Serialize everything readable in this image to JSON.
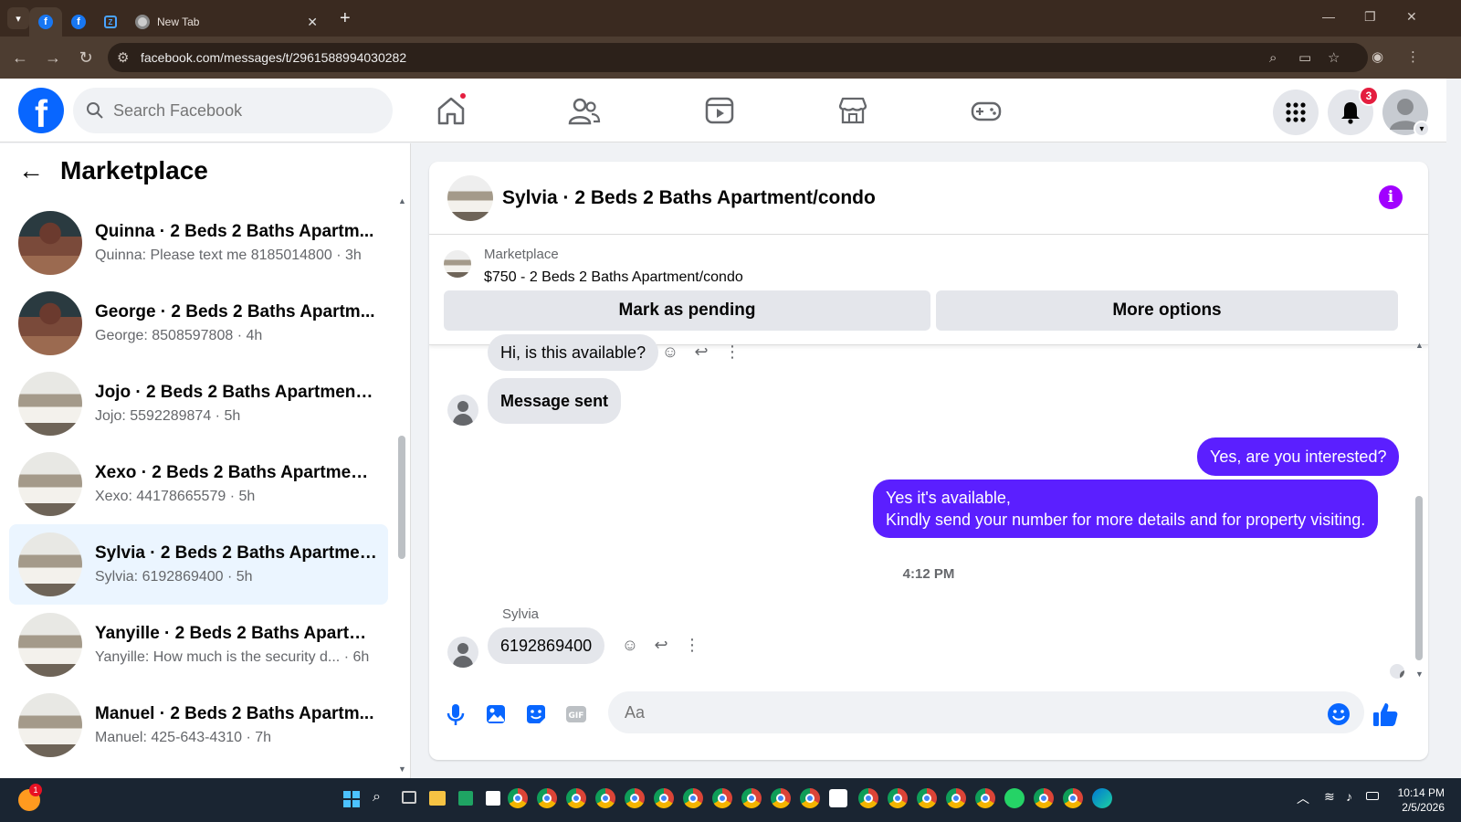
{
  "browser": {
    "tabs": [
      {
        "label": "",
        "icon": "facebook-icon",
        "active": true
      },
      {
        "label": "",
        "icon": "facebook-icon",
        "active": false
      },
      {
        "label": "",
        "icon": "zillow-icon",
        "active": false
      },
      {
        "label": "New Tab",
        "icon": "chrome-icon",
        "active": false
      }
    ],
    "url": "facebook.com/messages/t/2961588994030282"
  },
  "header": {
    "search_placeholder": "Search Facebook",
    "notifications_count": "3"
  },
  "sidebar": {
    "title": "Marketplace",
    "conversations": [
      {
        "name": "Quinna · 2 Beds 2 Baths Apartm...",
        "preview": "Quinna: Please text me 8185014800 · 3h",
        "thumb": "dark",
        "selected": false
      },
      {
        "name": "George · 2 Beds 2 Baths Apartm...",
        "preview": "George: 8508597808 · 4h",
        "thumb": "dark",
        "selected": false
      },
      {
        "name": "Jojo · 2 Beds 2 Baths Apartment/...",
        "preview": "Jojo: 5592289874 · 5h",
        "thumb": "light",
        "selected": false
      },
      {
        "name": "Xexo · 2 Beds 2 Baths Apartment...",
        "preview": "Xexo: 44178665579 · 5h",
        "thumb": "light",
        "selected": false
      },
      {
        "name": "Sylvia · 2 Beds 2 Baths Apartmen...",
        "preview": "Sylvia: 6192869400 · 5h",
        "thumb": "light",
        "selected": true
      },
      {
        "name": "Yanyille · 2 Beds 2 Baths Apartm...",
        "preview": "Yanyille: How much is the security d... · 6h",
        "thumb": "light",
        "selected": false
      },
      {
        "name": "Manuel · 2 Beds 2 Baths Apartm...",
        "preview": "Manuel: 425-643-4310 · 7h",
        "thumb": "light",
        "selected": false
      }
    ]
  },
  "chat": {
    "title": "Sylvia · 2 Beds 2 Baths Apartment/condo",
    "listing_source": "Marketplace",
    "listing_title": "$750 - 2 Beds 2 Baths Apartment/condo",
    "mark_pending_label": "Mark as pending",
    "more_options_label": "More options",
    "messages": {
      "in1": "Hi, is this available?",
      "in2": "Message sent",
      "out1": "Yes, are you interested?",
      "out2_line1": "Yes it's available,",
      "out2_line2": "Kindly send your number for more details and for property visiting.",
      "timestamp": "4:12 PM",
      "sender": "Sylvia",
      "in3": "6192869400"
    },
    "composer_placeholder": "Aa"
  },
  "taskbar": {
    "time": "10:14 PM",
    "date": "2/5/2026",
    "notif_badge": "1"
  },
  "colors": {
    "fb_blue": "#0866ff",
    "bubble_out": "#5b1fff",
    "info_purple": "#a100ff",
    "selected_row": "#ebf5ff"
  }
}
